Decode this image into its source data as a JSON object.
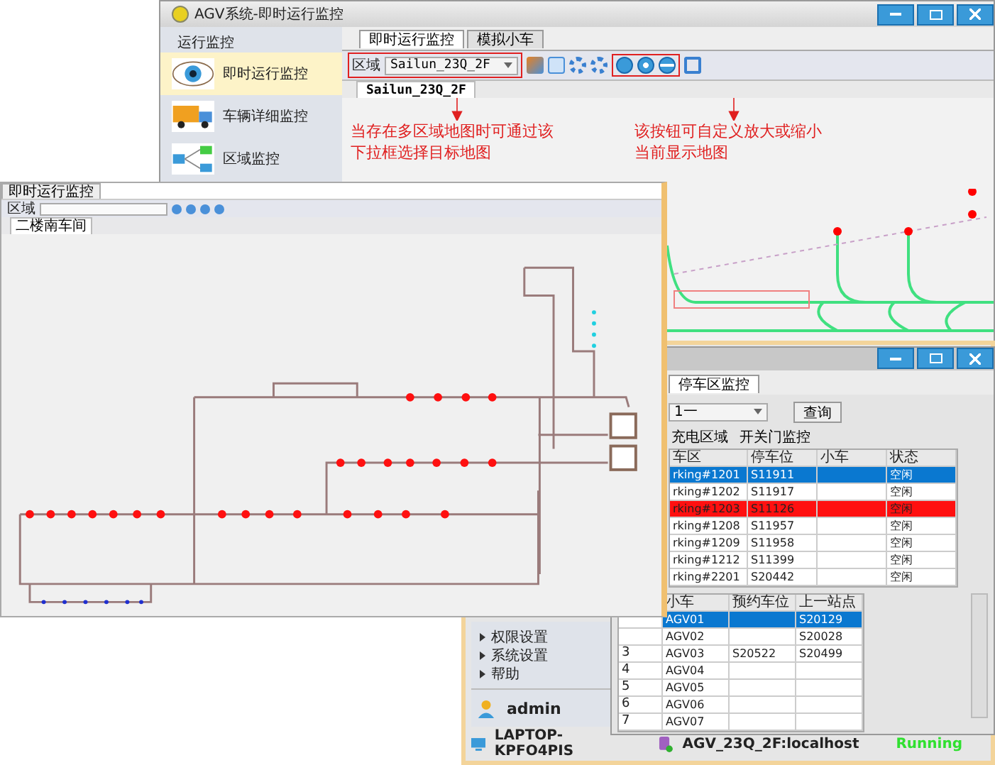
{
  "main_window": {
    "title": "AGV系统-即时运行监控",
    "sidebar": {
      "group": "运行监控",
      "items": [
        {
          "label": "即时运行监控",
          "kind": "eye",
          "selected": true
        },
        {
          "label": "车辆详细监控",
          "kind": "truck",
          "selected": false
        },
        {
          "label": "区域监控",
          "kind": "nodes",
          "selected": false
        }
      ]
    },
    "tabs": [
      {
        "label": "即时运行监控",
        "selected": true
      },
      {
        "label": "模拟小车",
        "selected": false
      }
    ],
    "toolbar": {
      "area_label": "区域",
      "area_select": "Sailun_23Q_2F"
    },
    "map_tab": "Sailun_23Q_2F",
    "annotations": [
      "当存在多区域地图时可通过该下拉框选择目标地图",
      "该按钮可自定义放大或缩小当前显示地图"
    ]
  },
  "map_window": {
    "tab": "即时运行监控",
    "area_label": "区域",
    "map_tab": "二楼南车间"
  },
  "parking_window": {
    "tab": "停车区监控",
    "area_select": "1一",
    "query_button": "查询",
    "subtabs": [
      "充电区域",
      "开关门监控"
    ],
    "parking_table": {
      "columns": [
        "车区",
        "停车位",
        "小车",
        "状态"
      ],
      "rows": [
        {
          "zone": "rking#1201",
          "spot": "S11911",
          "status": "空闲",
          "selected": true,
          "alarm": false
        },
        {
          "zone": "rking#1202",
          "spot": "S11917",
          "status": "空闲",
          "selected": false,
          "alarm": false
        },
        {
          "zone": "rking#1203",
          "spot": "S11126",
          "status": "空闲",
          "selected": false,
          "alarm": true
        },
        {
          "zone": "rking#1208",
          "spot": "S11957",
          "status": "空闲",
          "selected": false,
          "alarm": false
        },
        {
          "zone": "rking#1209",
          "spot": "S11958",
          "status": "空闲",
          "selected": false,
          "alarm": false
        },
        {
          "zone": "rking#1212",
          "spot": "S11399",
          "status": "空闲",
          "selected": false,
          "alarm": false
        },
        {
          "zone": "rking#2201",
          "spot": "S20442",
          "status": "空闲",
          "selected": false,
          "alarm": false
        }
      ]
    },
    "vehicle_table": {
      "columns": [
        "小车",
        "预约车位",
        "上一站点"
      ],
      "rows": [
        {
          "agv": "AGV01",
          "last": "S20129",
          "selected": true
        },
        {
          "agv": "AGV02",
          "last": "S20028",
          "selected": false
        },
        {
          "no": "3",
          "agv": "AGV03",
          "reserved": "S20522",
          "last": "S20499",
          "selected": false
        },
        {
          "no": "4",
          "agv": "AGV04",
          "selected": false
        },
        {
          "no": "5",
          "agv": "AGV05",
          "selected": false
        },
        {
          "no": "6",
          "agv": "AGV06",
          "selected": false
        },
        {
          "no": "7",
          "agv": "AGV07",
          "selected": false
        }
      ]
    }
  },
  "admin_window": {
    "menu": [
      "权限设置",
      "系统设置",
      "帮助"
    ],
    "user": "admin",
    "status_bar": {
      "host": "LAPTOP-KPFO4PIS",
      "database": "AGV_23Q_2F:localhost",
      "state": "Running"
    }
  }
}
